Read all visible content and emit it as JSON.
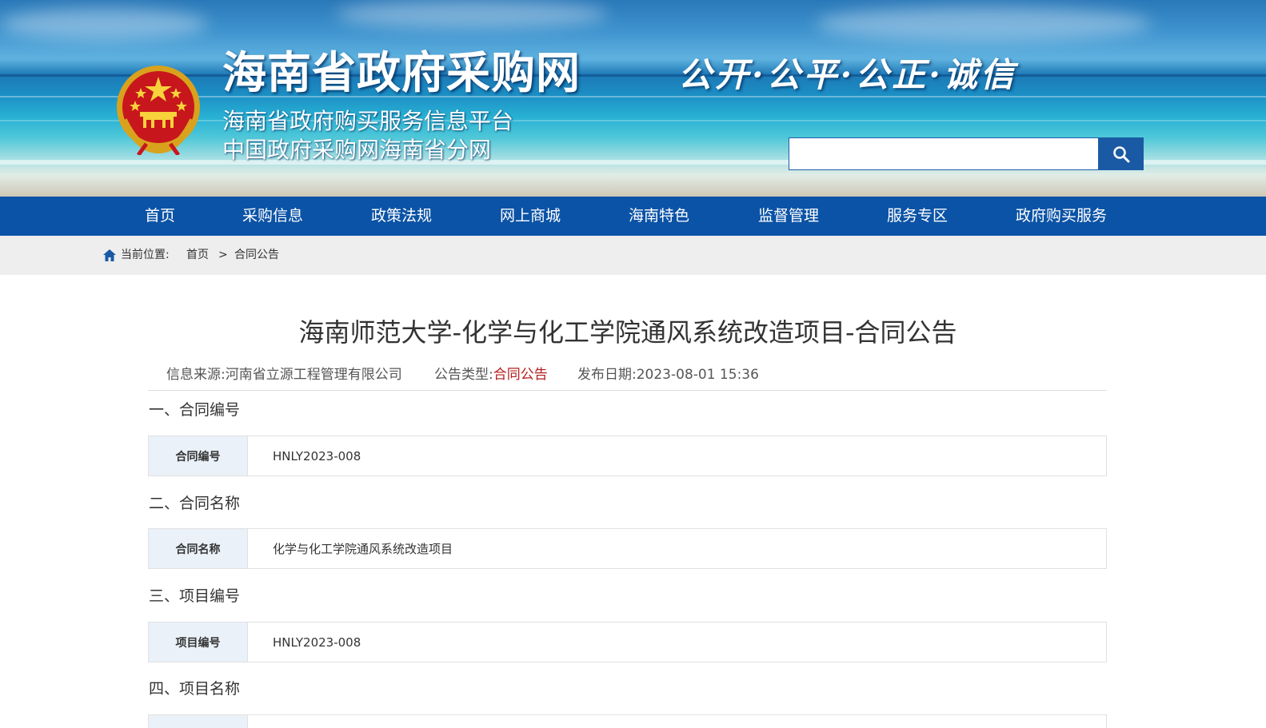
{
  "header": {
    "site_title": "海南省政府采购网",
    "subtitle_1": "海南省政府购买服务信息平台",
    "subtitle_2": "中国政府采购网海南省分网",
    "motto": "公开·公平·公正·诚信",
    "emblem_icon": "national-emblem",
    "search": {
      "value": "",
      "placeholder": "",
      "button_icon": "search-icon"
    }
  },
  "nav": {
    "items": [
      {
        "label": "首页"
      },
      {
        "label": "采购信息"
      },
      {
        "label": "政策法规"
      },
      {
        "label": "网上商城"
      },
      {
        "label": "海南特色"
      },
      {
        "label": "监督管理"
      },
      {
        "label": "服务专区"
      },
      {
        "label": "政府购买服务"
      }
    ]
  },
  "breadcrumb": {
    "icon": "home-icon",
    "prefix": "当前位置:",
    "home": "首页",
    "separator": ">",
    "current": "合同公告"
  },
  "notice": {
    "title": "海南师范大学-化学与化工学院通风系统改造项目-合同公告",
    "source_label": "信息来源:",
    "source_value": "河南省立源工程管理有限公司",
    "type_label": "公告类型:",
    "type_value": "合同公告",
    "date_label": "发布日期:",
    "date_value": "2023-08-01 15:36",
    "sections": [
      {
        "heading": "一、合同编号",
        "key": "合同编号",
        "value": "HNLY2023-008"
      },
      {
        "heading": "二、合同名称",
        "key": "合同名称",
        "value": "化学与化工学院通风系统改造项目"
      },
      {
        "heading": "三、项目编号",
        "key": "项目编号",
        "value": "HNLY2023-008"
      },
      {
        "heading": "四、项目名称"
      }
    ]
  },
  "colors": {
    "nav_bg": "#0b53a6",
    "search_button": "#1a5aa5",
    "breadcrumb_bg": "#eeeeee",
    "notice_type_text": "#b31b1b",
    "table_key_bg": "#eaf1f8"
  }
}
